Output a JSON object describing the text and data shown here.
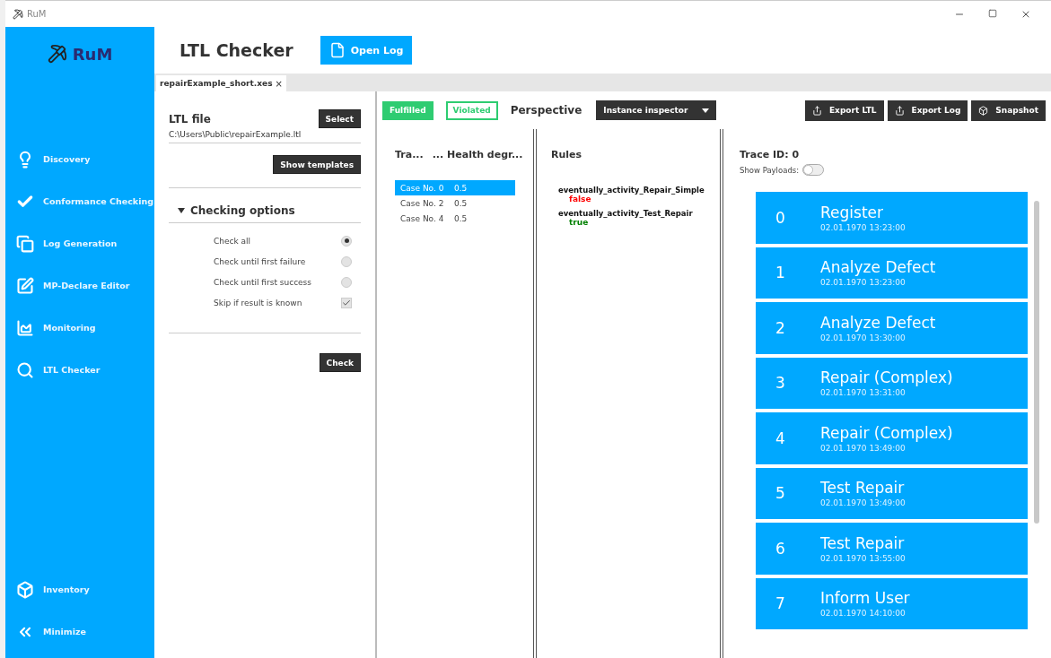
{
  "window": {
    "title": "RuM"
  },
  "sidebar": {
    "logo": "RuM",
    "items": [
      {
        "label": "Discovery",
        "kind": "bulb"
      },
      {
        "label": "Conformance Checking",
        "kind": "check"
      },
      {
        "label": "Log Generation",
        "kind": "pages"
      },
      {
        "label": "MP-Declare Editor",
        "kind": "edit"
      },
      {
        "label": "Monitoring",
        "kind": "chart"
      },
      {
        "label": "LTL Checker",
        "kind": "search"
      }
    ],
    "bottom": [
      {
        "label": "Inventory",
        "kind": "box"
      },
      {
        "label": "Minimize",
        "kind": "collapse"
      }
    ]
  },
  "header": {
    "title": "LTL Checker",
    "open_button": "Open Log"
  },
  "tabs": [
    {
      "label": "repairExample_short.xes",
      "close": "×",
      "selected": true
    }
  ],
  "ltl_panel": {
    "title": "LTL file",
    "select_button": "Select",
    "path": "C:\\Users\\Public\\repairExample.ltl",
    "templates_button": "Show templates",
    "options_title": "Checking options",
    "options_expanded": true,
    "options": [
      {
        "label": "Check all",
        "kind": "radio",
        "checked": true
      },
      {
        "label": "Check until first failure",
        "kind": "radio",
        "checked": false
      },
      {
        "label": "Check until first success",
        "kind": "radio",
        "checked": false
      },
      {
        "label": "Skip if result is known",
        "kind": "checkbox",
        "checked": true
      }
    ],
    "check_button": "Check"
  },
  "toolbar": {
    "filters": [
      {
        "label": "Fulfilled",
        "selected": true
      },
      {
        "label": "Violated",
        "selected": false
      }
    ],
    "perspective_label": "Perspective",
    "perspective": "Instance inspector",
    "actions": [
      {
        "label": "Export LTL",
        "kind": "export"
      },
      {
        "label": "Export Log",
        "kind": "export"
      },
      {
        "label": "Snapshot",
        "kind": "cube"
      }
    ]
  },
  "traces": {
    "columns": [
      "Tra...",
      "... Health degr..."
    ],
    "rows": [
      {
        "cells": [
          "Case No. 0",
          "0.5"
        ],
        "selected": true
      },
      {
        "cells": [
          "Case No. 2",
          "0.5"
        ],
        "selected": false
      },
      {
        "cells": [
          "Case No. 4",
          "0.5"
        ],
        "selected": false
      }
    ]
  },
  "rules": {
    "title": "Rules",
    "items": [
      {
        "name": "eventually_activity_Repair_Simple",
        "result": "false",
        "color": "#ff0000"
      },
      {
        "name": "eventually_activity_Test_Repair",
        "result": "true",
        "color": "#008000"
      }
    ]
  },
  "trace_view": {
    "title": "Trace ID: 0",
    "payloads_label": "Show Payloads:",
    "payloads_on": false,
    "events": [
      {
        "index": "0",
        "name": "Register",
        "time": "02.01.1970 13:23:00"
      },
      {
        "index": "1",
        "name": "Analyze Defect",
        "time": "02.01.1970 13:23:00"
      },
      {
        "index": "2",
        "name": "Analyze Defect",
        "time": "02.01.1970 13:30:00"
      },
      {
        "index": "3",
        "name": "Repair (Complex)",
        "time": "02.01.1970 13:31:00"
      },
      {
        "index": "4",
        "name": "Repair (Complex)",
        "time": "02.01.1970 13:49:00"
      },
      {
        "index": "5",
        "name": "Test Repair",
        "time": "02.01.1970 13:49:00"
      },
      {
        "index": "6",
        "name": "Test Repair",
        "time": "02.01.1970 13:55:00"
      },
      {
        "index": "7",
        "name": "Inform User",
        "time": "02.01.1970 14:10:00"
      }
    ]
  }
}
